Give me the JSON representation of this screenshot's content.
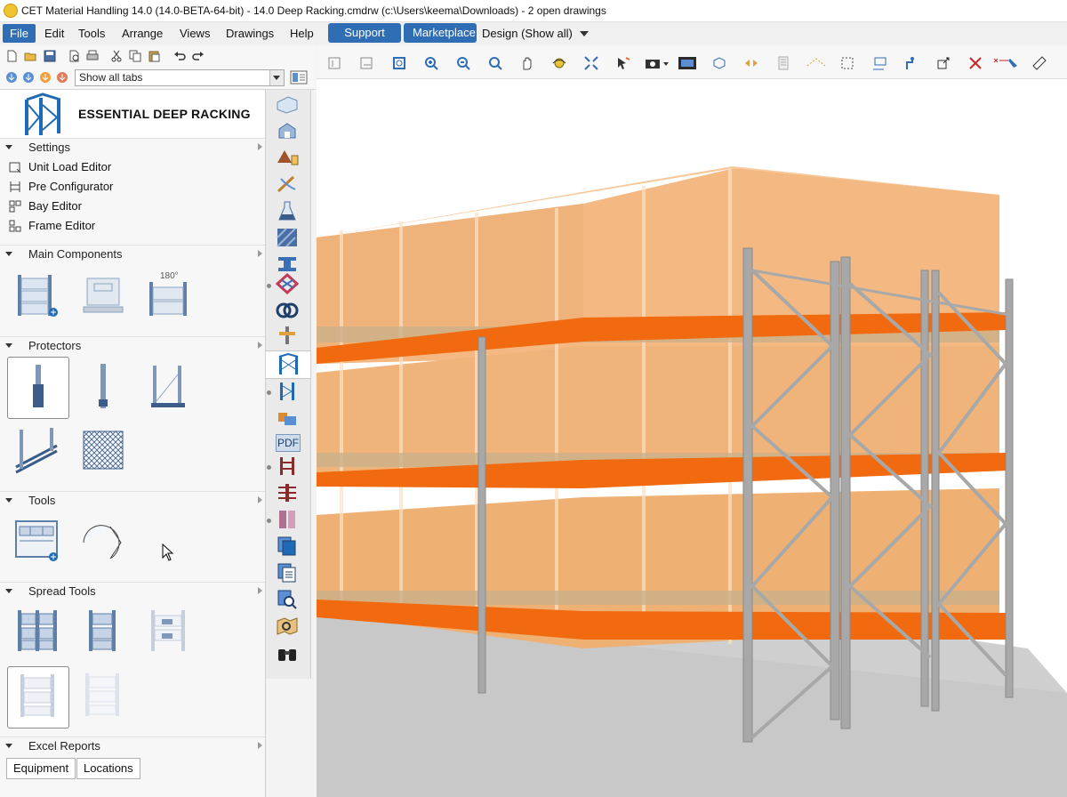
{
  "window": {
    "title": "CET Material Handling 14.0 (14.0-BETA-64-bit) - 14.0 Deep Racking.cmdrw (c:\\Users\\keema\\Downloads) - 2  open drawings"
  },
  "menu": {
    "items": [
      "File",
      "Edit",
      "Tools",
      "Arrange",
      "Views",
      "Drawings",
      "Help"
    ],
    "support_label": "Support",
    "marketplace_label": "Marketplace",
    "design_label": "Design (Show all)"
  },
  "left_toolbar": {
    "tab_filter_value": "Show all tabs"
  },
  "panel": {
    "title": "ESSENTIAL DEEP RACKING",
    "sections": {
      "settings": "Settings",
      "main_components": "Main Components",
      "protectors": "Protectors",
      "tools": "Tools",
      "spread_tools": "Spread Tools",
      "excel_reports": "Excel Reports"
    },
    "settings_items": [
      "Unit Load Editor",
      "Pre Configurator",
      "Bay Editor",
      "Frame Editor"
    ],
    "excel_buttons": [
      "Equipment",
      "Locations"
    ],
    "main_components_rotate_label": "180°"
  },
  "vertical_strip": {
    "pdf_label": "PDF"
  },
  "colors": {
    "accent_blue": "#2f6db5",
    "beam_orange": "#f26a10",
    "carton": "#f0b47a",
    "upright_grey": "#a8a8a8",
    "floor_grey": "#c8c8c8"
  }
}
